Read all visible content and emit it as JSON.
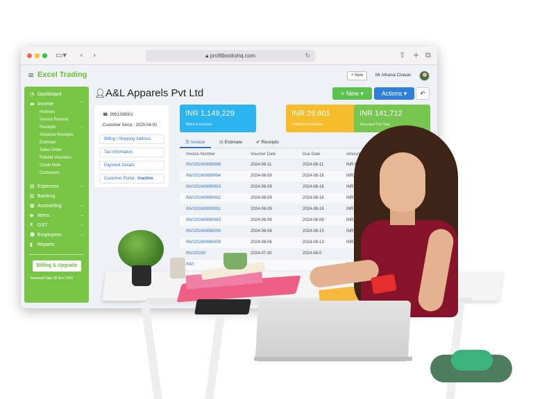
{
  "browser": {
    "url": "profitbookshq.com"
  },
  "app": {
    "brand": "Excel Trading",
    "header_new": "+ New",
    "user_name": "Mr Atharva Chavan"
  },
  "sidebar": {
    "items": [
      {
        "label": "Dashboard",
        "icon": "dashboard-icon"
      },
      {
        "label": "Income",
        "icon": "income-icon"
      },
      {
        "label": "Expenses",
        "icon": "expenses-icon"
      },
      {
        "label": "Banking",
        "icon": "banking-icon"
      },
      {
        "label": "Accounting",
        "icon": "accounting-icon"
      },
      {
        "label": "Items",
        "icon": "items-icon"
      },
      {
        "label": "GST",
        "icon": "gst-icon"
      },
      {
        "label": "Employees",
        "icon": "employees-icon"
      },
      {
        "label": "Reports",
        "icon": "reports-icon"
      }
    ],
    "income_sub": [
      "Invoices",
      "Invoice Returns",
      "Receipts",
      "Advance Receipts",
      "Estimate",
      "Sales Order",
      "Refund Vouchers",
      "Credit Note",
      "Customers"
    ],
    "upgrade": "Billing & Upgrade",
    "renewal": "Renewal Date 30 Nov 2050"
  },
  "page": {
    "title": "A&L Apparels Pvt Ltd",
    "new_button": "+ New",
    "actions_button": "Actions"
  },
  "customer": {
    "phone": "9991299002",
    "since": "Customer Since : 2020-04-02",
    "billing": "Billing / Shipping Address",
    "tax": "Tax Information",
    "payment": "Payment Details",
    "portal_label": "Customer Portal :",
    "portal_status": "Inactive"
  },
  "stats": [
    {
      "amount": "INR 1,149,229",
      "label": "Billed in Invoices",
      "color": "#2bb4f0"
    },
    {
      "amount": "INR 29,601",
      "label": "Unbilled in Estimate",
      "color": "#f5bd2b"
    },
    {
      "amount": "INR 141,712",
      "label": "Received This Year",
      "color": "#77c64f"
    }
  ],
  "tabs": [
    "Invoice",
    "Estimate",
    "Receipts"
  ],
  "table": {
    "headers": [
      "Invoice Number",
      "Voucher Date",
      "Due Date",
      "Amount"
    ],
    "rows": [
      [
        "INV/20240809/066",
        "2024-08-11",
        "2024-08-11",
        "INR 67,2"
      ],
      [
        "INV/20240809/064",
        "2024-08-09",
        "2024-08-16",
        "INR 2,24"
      ],
      [
        "INV/20240809/063",
        "2024-08-09",
        "2024-08-16",
        "INR 2,2"
      ],
      [
        "INV/20240809/062",
        "2024-08-09",
        "2024-08-16",
        "INR 2,2"
      ],
      [
        "INV/20240809/061",
        "2024-08-09",
        "2024-08-16",
        "INR"
      ],
      [
        "INV/20240809/063",
        "2024-08-08",
        "2024-08-08",
        "INR"
      ],
      [
        "INV/20240808/060",
        "2024-08-08",
        "2024-08-15",
        "INR"
      ],
      [
        "INV/20240806/059",
        "2024-08-06",
        "2024-08-13",
        "INR"
      ],
      [
        "INV/20240",
        "2024-07-30",
        "2024-08-0",
        ""
      ],
      [
        "INV/",
        "",
        "",
        "INR 2"
      ]
    ]
  }
}
